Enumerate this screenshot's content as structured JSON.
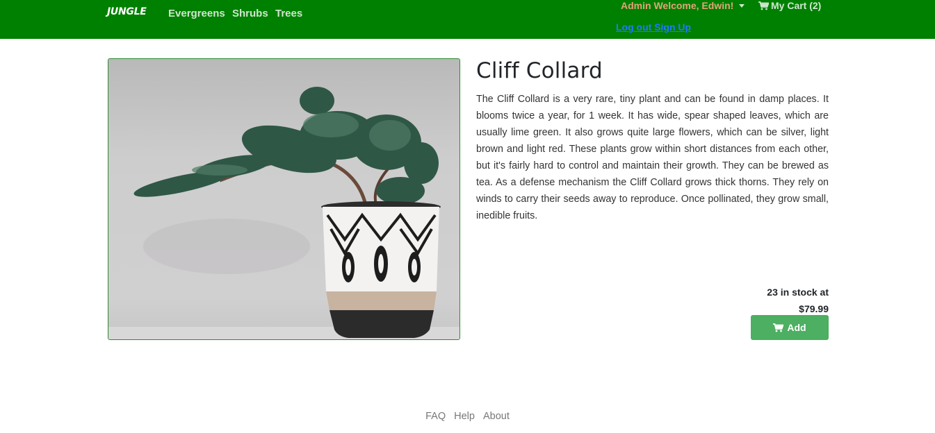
{
  "nav": {
    "brand": "JUNGLE",
    "links": [
      "Evergreens",
      "Shrubs",
      "Trees"
    ],
    "admin": "Admin Welcome, Edwin!",
    "cart": "My Cart (2)",
    "logout": "Log out",
    "signup": "Sign Up"
  },
  "product": {
    "title": "Cliff Collard",
    "description": "The Cliff Collard is a very rare, tiny plant and can be found in damp places. It blooms twice a year, for 1 week. It has wide, spear shaped leaves, which are usually lime green. It also grows quite large flowers, which can be silver, light brown and light red. These plants grow within short distances from each other, but it's fairly hard to control and maintain their growth. They can be brewed as tea. As a defense mechanism the Cliff Collard grows thick thorns. They rely on winds to carry their seeds away to reproduce. Once pollinated, they grow small, inedible fruits.",
    "stock_line": "23 in stock at",
    "price": "$79.99",
    "add_label": "Add"
  },
  "footer": {
    "links": [
      "FAQ",
      "Help",
      "About"
    ]
  },
  "colors": {
    "navbar": "#008000",
    "add_button": "#4caf62",
    "admin_text": "#e6a27a",
    "auth_link": "#1e7bff"
  },
  "icons": {
    "cart": "cart-icon",
    "dropdown": "caret-down-icon"
  }
}
